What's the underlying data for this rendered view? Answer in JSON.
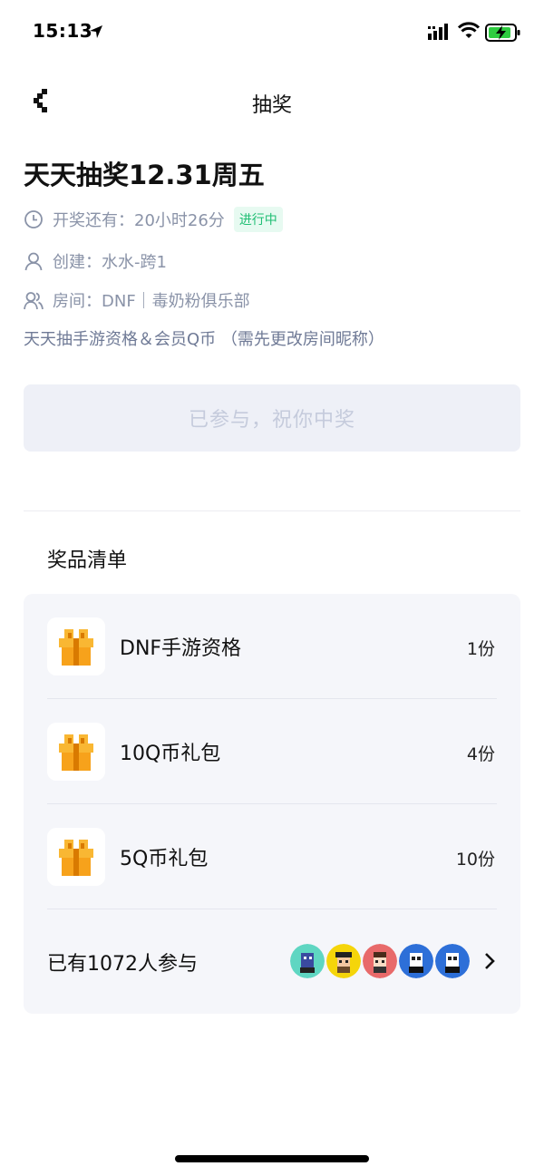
{
  "status_bar": {
    "time": "15:13"
  },
  "nav": {
    "title": "抽奖"
  },
  "lottery": {
    "title": "天天抽奖12.31周五",
    "countdown_label": "开奖还有：",
    "countdown_value": "20小时26分",
    "status": "进行中",
    "creator_label": "创建：",
    "creator_name": "水水-跨1",
    "room_label": "房间：",
    "room_name": "DNF｜毒奶粉俱乐部",
    "description": "天天抽手游资格＆会员Q币 （需先更改房间昵称）",
    "join_button_label": "已参与，祝你中奖"
  },
  "prizes": {
    "heading": "奖品清单",
    "items": [
      {
        "name": "DNF手游资格",
        "count": "1份",
        "icon": "gift-icon"
      },
      {
        "name": "10Q币礼包",
        "count": "4份",
        "icon": "gift-icon"
      },
      {
        "name": "5Q币礼包",
        "count": "10份",
        "icon": "gift-icon"
      }
    ]
  },
  "participants": {
    "text": "已有1072人参与",
    "avatar_colors": [
      "#5fd6c2",
      "#f5d50a",
      "#e86a6a",
      "#2d6fd8",
      "#2d6fd8"
    ]
  },
  "colors": {
    "status_green": "#1fbe73",
    "muted_text": "#8a93a8",
    "card_bg": "#f5f6fa",
    "gift_orange": "#f7a21b"
  }
}
